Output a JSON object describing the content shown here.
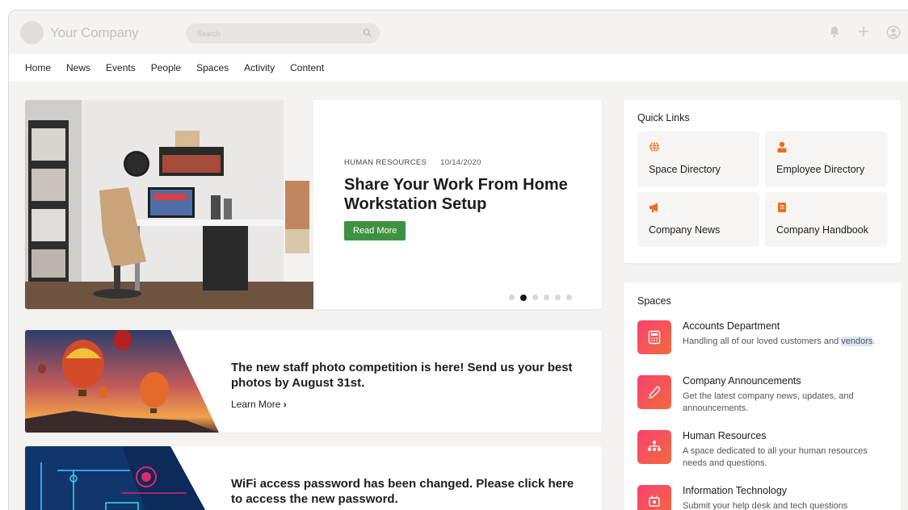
{
  "header": {
    "company_name": "Your Company",
    "search_placeholder": "Search",
    "icons": [
      "bell-icon",
      "plus-icon",
      "user-circle-icon"
    ]
  },
  "nav": {
    "items": [
      "Home",
      "News",
      "Events",
      "People",
      "Spaces",
      "Activity",
      "Content"
    ]
  },
  "hero": {
    "category": "HUMAN RESOURCES",
    "date": "10/14/2020",
    "title": "Share Your Work From Home Workstation Setup",
    "button_label": "Read More",
    "carousel_count": 6,
    "carousel_active_index": 1,
    "button_color": "#3f9142"
  },
  "news": [
    {
      "title": "The new staff photo competition is here! Send us your best photos by August 31st.",
      "link_label": "Learn More"
    },
    {
      "title": "WiFi access password has been changed. Please click here to access the new password."
    }
  ],
  "quick_links": {
    "title": "Quick Links",
    "items": [
      {
        "label": "Space Directory",
        "icon": "globe-icon"
      },
      {
        "label": "Employee Directory",
        "icon": "person-icon"
      },
      {
        "label": "Company News",
        "icon": "megaphone-icon"
      },
      {
        "label": "Company Handbook",
        "icon": "book-icon"
      }
    ],
    "accent_color": "#f26b1d"
  },
  "spaces": {
    "title": "Spaces",
    "items": [
      {
        "name": "Accounts Department",
        "desc_main": "Handling all of our loved customers and ",
        "desc_highlight": "vendors",
        "desc_end": ".",
        "icon": "calculator-icon"
      },
      {
        "name": "Company Announcements",
        "desc": "Get the latest company news, updates, and announcements.",
        "icon": "pen-icon"
      },
      {
        "name": "Human Resources",
        "desc": "A space dedicated to all your human resources needs and questions.",
        "icon": "people-network-icon"
      },
      {
        "name": "Information Technology",
        "desc": "Submit your help desk and tech questions",
        "icon": "tech-icon"
      }
    ]
  }
}
